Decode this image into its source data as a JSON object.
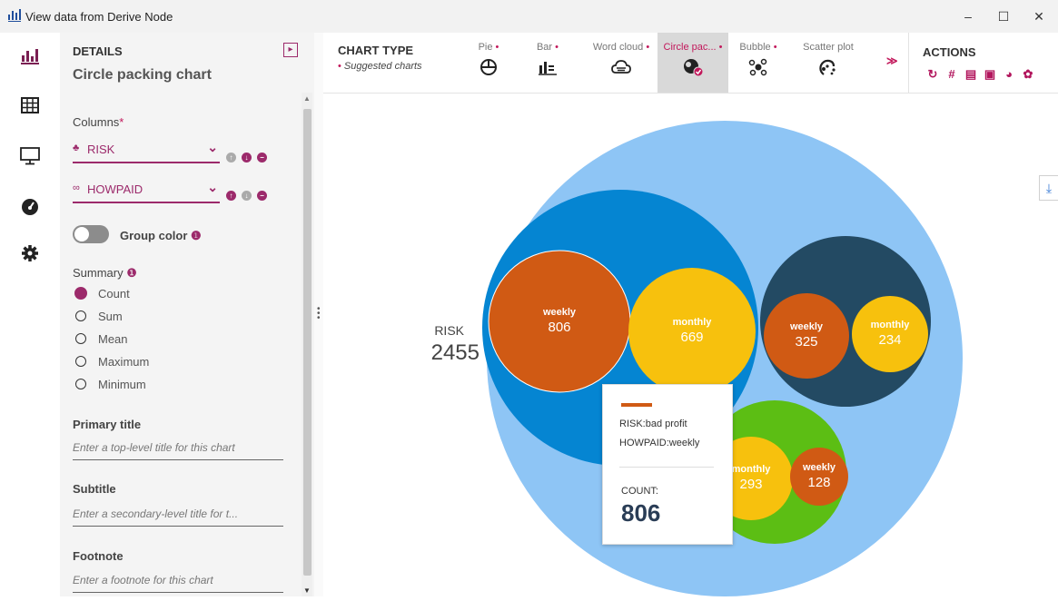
{
  "window": {
    "title": "View data from Derive Node",
    "minimize": "–",
    "maximize": "☐",
    "close": "✕"
  },
  "details": {
    "header": "DETAILS",
    "title": "Circle packing chart",
    "columns_label": "Columns",
    "required_mark": "*",
    "columns": [
      {
        "name": "RISK",
        "icon": "category-icon"
      },
      {
        "name": "HOWPAID",
        "icon": "link-icon"
      }
    ],
    "group_color_label": "Group color",
    "summary_label": "Summary",
    "summary_options": [
      "Count",
      "Sum",
      "Mean",
      "Maximum",
      "Minimum"
    ],
    "summary_selected": "Count",
    "primary_title_label": "Primary title",
    "primary_title_placeholder": "Enter a top-level title for this chart",
    "subtitle_label": "Subtitle",
    "subtitle_placeholder": "Enter a secondary-level title for t...",
    "footnote_label": "Footnote",
    "footnote_placeholder": "Enter a footnote for this chart"
  },
  "chart_type": {
    "label": "CHART TYPE",
    "suggested": "Suggested charts",
    "tabs": [
      {
        "name": "Pie",
        "suggested": true,
        "icon": "pie-icon"
      },
      {
        "name": "Bar",
        "suggested": true,
        "icon": "bar-icon"
      },
      {
        "name": "Word cloud",
        "suggested": true,
        "icon": "cloud-icon"
      },
      {
        "name": "Circle pac...",
        "suggested": true,
        "icon": "circle-packing-icon",
        "selected": true
      },
      {
        "name": "Bubble",
        "suggested": true,
        "icon": "bubble-icon"
      },
      {
        "name": "Scatter plot",
        "suggested": false,
        "icon": "scatter-icon"
      }
    ],
    "more": "≫"
  },
  "actions": {
    "label": "ACTIONS",
    "items": [
      "refresh-icon",
      "hash-icon",
      "code-icon",
      "image-icon",
      "dashboard-icon",
      "gear-icon"
    ]
  },
  "chart_data": {
    "type": "circle-packing",
    "root": {
      "name": "RISK",
      "value": 2455
    },
    "groups": [
      {
        "name": "bad profit",
        "color": "#0585d2",
        "children": [
          {
            "name": "weekly",
            "value": 806,
            "color": "#d05a14"
          },
          {
            "name": "monthly",
            "value": 669,
            "color": "#f7c10d"
          }
        ]
      },
      {
        "name": "",
        "color": "#234a63",
        "children": [
          {
            "name": "weekly",
            "value": 325,
            "color": "#d05a14"
          },
          {
            "name": "monthly",
            "value": 234,
            "color": "#f7c10d"
          }
        ]
      },
      {
        "name": "",
        "color": "#5cbe14",
        "children": [
          {
            "name": "monthly",
            "value": 293,
            "color": "#f7c10d"
          },
          {
            "name": "weekly",
            "value": 128,
            "color": "#d05a14"
          }
        ]
      }
    ],
    "root_color": "#8ec5f5"
  },
  "tooltip": {
    "line1": "RISK:bad profit",
    "line2": "HOWPAID:weekly",
    "count_label": "COUNT:",
    "count_value": "806"
  }
}
